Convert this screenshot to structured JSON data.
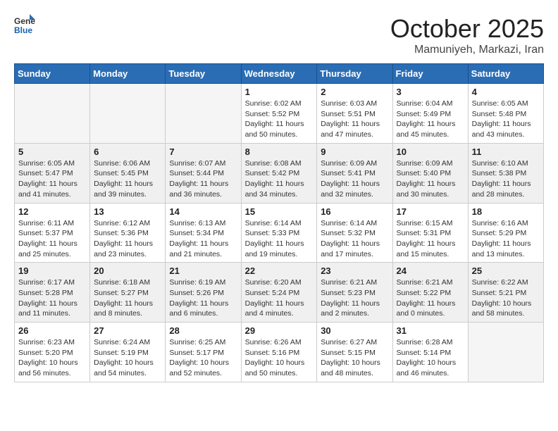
{
  "header": {
    "logo_line1": "General",
    "logo_line2": "Blue",
    "month_year": "October 2025",
    "location": "Mamuniyeh, Markazi, Iran"
  },
  "weekdays": [
    "Sunday",
    "Monday",
    "Tuesday",
    "Wednesday",
    "Thursday",
    "Friday",
    "Saturday"
  ],
  "weeks": [
    [
      {
        "day": "",
        "info": ""
      },
      {
        "day": "",
        "info": ""
      },
      {
        "day": "",
        "info": ""
      },
      {
        "day": "1",
        "info": "Sunrise: 6:02 AM\nSunset: 5:52 PM\nDaylight: 11 hours\nand 50 minutes."
      },
      {
        "day": "2",
        "info": "Sunrise: 6:03 AM\nSunset: 5:51 PM\nDaylight: 11 hours\nand 47 minutes."
      },
      {
        "day": "3",
        "info": "Sunrise: 6:04 AM\nSunset: 5:49 PM\nDaylight: 11 hours\nand 45 minutes."
      },
      {
        "day": "4",
        "info": "Sunrise: 6:05 AM\nSunset: 5:48 PM\nDaylight: 11 hours\nand 43 minutes."
      }
    ],
    [
      {
        "day": "5",
        "info": "Sunrise: 6:05 AM\nSunset: 5:47 PM\nDaylight: 11 hours\nand 41 minutes."
      },
      {
        "day": "6",
        "info": "Sunrise: 6:06 AM\nSunset: 5:45 PM\nDaylight: 11 hours\nand 39 minutes."
      },
      {
        "day": "7",
        "info": "Sunrise: 6:07 AM\nSunset: 5:44 PM\nDaylight: 11 hours\nand 36 minutes."
      },
      {
        "day": "8",
        "info": "Sunrise: 6:08 AM\nSunset: 5:42 PM\nDaylight: 11 hours\nand 34 minutes."
      },
      {
        "day": "9",
        "info": "Sunrise: 6:09 AM\nSunset: 5:41 PM\nDaylight: 11 hours\nand 32 minutes."
      },
      {
        "day": "10",
        "info": "Sunrise: 6:09 AM\nSunset: 5:40 PM\nDaylight: 11 hours\nand 30 minutes."
      },
      {
        "day": "11",
        "info": "Sunrise: 6:10 AM\nSunset: 5:38 PM\nDaylight: 11 hours\nand 28 minutes."
      }
    ],
    [
      {
        "day": "12",
        "info": "Sunrise: 6:11 AM\nSunset: 5:37 PM\nDaylight: 11 hours\nand 25 minutes."
      },
      {
        "day": "13",
        "info": "Sunrise: 6:12 AM\nSunset: 5:36 PM\nDaylight: 11 hours\nand 23 minutes."
      },
      {
        "day": "14",
        "info": "Sunrise: 6:13 AM\nSunset: 5:34 PM\nDaylight: 11 hours\nand 21 minutes."
      },
      {
        "day": "15",
        "info": "Sunrise: 6:14 AM\nSunset: 5:33 PM\nDaylight: 11 hours\nand 19 minutes."
      },
      {
        "day": "16",
        "info": "Sunrise: 6:14 AM\nSunset: 5:32 PM\nDaylight: 11 hours\nand 17 minutes."
      },
      {
        "day": "17",
        "info": "Sunrise: 6:15 AM\nSunset: 5:31 PM\nDaylight: 11 hours\nand 15 minutes."
      },
      {
        "day": "18",
        "info": "Sunrise: 6:16 AM\nSunset: 5:29 PM\nDaylight: 11 hours\nand 13 minutes."
      }
    ],
    [
      {
        "day": "19",
        "info": "Sunrise: 6:17 AM\nSunset: 5:28 PM\nDaylight: 11 hours\nand 11 minutes."
      },
      {
        "day": "20",
        "info": "Sunrise: 6:18 AM\nSunset: 5:27 PM\nDaylight: 11 hours\nand 8 minutes."
      },
      {
        "day": "21",
        "info": "Sunrise: 6:19 AM\nSunset: 5:26 PM\nDaylight: 11 hours\nand 6 minutes."
      },
      {
        "day": "22",
        "info": "Sunrise: 6:20 AM\nSunset: 5:24 PM\nDaylight: 11 hours\nand 4 minutes."
      },
      {
        "day": "23",
        "info": "Sunrise: 6:21 AM\nSunset: 5:23 PM\nDaylight: 11 hours\nand 2 minutes."
      },
      {
        "day": "24",
        "info": "Sunrise: 6:21 AM\nSunset: 5:22 PM\nDaylight: 11 hours\nand 0 minutes."
      },
      {
        "day": "25",
        "info": "Sunrise: 6:22 AM\nSunset: 5:21 PM\nDaylight: 10 hours\nand 58 minutes."
      }
    ],
    [
      {
        "day": "26",
        "info": "Sunrise: 6:23 AM\nSunset: 5:20 PM\nDaylight: 10 hours\nand 56 minutes."
      },
      {
        "day": "27",
        "info": "Sunrise: 6:24 AM\nSunset: 5:19 PM\nDaylight: 10 hours\nand 54 minutes."
      },
      {
        "day": "28",
        "info": "Sunrise: 6:25 AM\nSunset: 5:17 PM\nDaylight: 10 hours\nand 52 minutes."
      },
      {
        "day": "29",
        "info": "Sunrise: 6:26 AM\nSunset: 5:16 PM\nDaylight: 10 hours\nand 50 minutes."
      },
      {
        "day": "30",
        "info": "Sunrise: 6:27 AM\nSunset: 5:15 PM\nDaylight: 10 hours\nand 48 minutes."
      },
      {
        "day": "31",
        "info": "Sunrise: 6:28 AM\nSunset: 5:14 PM\nDaylight: 10 hours\nand 46 minutes."
      },
      {
        "day": "",
        "info": ""
      }
    ]
  ]
}
